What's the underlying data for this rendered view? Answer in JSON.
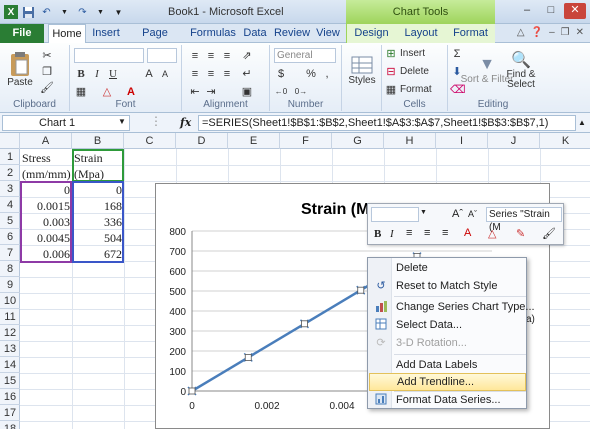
{
  "titlebar": {
    "title": "Book1  -  Microsoft Excel",
    "chart_tools": "Chart Tools",
    "qat": [
      "save-icon",
      "undo-icon",
      "redo-icon"
    ],
    "window_controls": [
      "–",
      "□",
      "✕"
    ]
  },
  "tabs": {
    "file": "File",
    "items": [
      "Home",
      "Insert",
      "Page Layout",
      "Formulas",
      "Data",
      "Review",
      "View",
      "Design",
      "Layout",
      "Format"
    ],
    "active": "Home"
  },
  "ribbon": {
    "clipboard": {
      "label": "Clipboard",
      "paste": "Paste"
    },
    "font": {
      "label": "Font",
      "bold": "B",
      "italic": "I",
      "underline": "U",
      "grow": "A",
      "shrink": "A"
    },
    "alignment": {
      "label": "Alignment"
    },
    "number": {
      "label": "Number",
      "format": "General",
      "currency": "$",
      "percent": "%",
      "comma": ","
    },
    "styles": {
      "label": "Styles"
    },
    "cells": {
      "label": "Cells",
      "insert": "Insert",
      "delete": "Delete",
      "format": "Format"
    },
    "editing": {
      "label": "Editing",
      "sort": "Sort & Filter",
      "find": "Find & Select"
    }
  },
  "formula_bar": {
    "name_box": "Chart 1",
    "fx": "fx",
    "formula": "=SERIES(Sheet1!$B$1:$B$2,Sheet1!$A$3:$A$7,Sheet1!$B$3:$B$7,1)"
  },
  "sheet": {
    "columns": [
      "A",
      "B",
      "C",
      "D",
      "E",
      "F",
      "G",
      "H",
      "I",
      "J",
      "K"
    ],
    "rows": [
      "1",
      "2",
      "3",
      "4",
      "5",
      "6",
      "7",
      "8",
      "9",
      "10",
      "11",
      "12",
      "13",
      "14",
      "15",
      "16",
      "17",
      "18"
    ],
    "cells": {
      "A1": "Stress",
      "B1": "Strain",
      "A2": "(mm/mm)",
      "B2": "(Mpa)",
      "A3": "0",
      "B3": "0",
      "A4": "0.0015",
      "B4": "168",
      "A5": "0.003",
      "B5": "336",
      "A6": "0.0045",
      "B6": "504",
      "A7": "0.006",
      "B7": "672"
    }
  },
  "chart": {
    "title": "Strain (M",
    "yaxis_ticks": [
      "800",
      "700",
      "600",
      "500",
      "400",
      "300",
      "200",
      "100",
      "0"
    ],
    "xaxis_ticks": [
      "0",
      "0.002",
      "0.004",
      "0.0"
    ],
    "legend_fragment": "a)"
  },
  "chart_data": {
    "type": "scatter",
    "title": "Strain (Mpa)",
    "series": [
      {
        "name": "Strain (Mpa)",
        "x": [
          0,
          0.0015,
          0.003,
          0.0045,
          0.006
        ],
        "y": [
          0,
          168,
          336,
          504,
          672
        ]
      }
    ],
    "xlim": [
      0,
      0.008
    ],
    "ylim": [
      0,
      800
    ],
    "grid": true,
    "line_color": "#4a7ebb"
  },
  "mini_toolbar": {
    "series_select": "Series \"Strain (M",
    "bold": "B",
    "italic": "I",
    "font_color_letter": "A"
  },
  "context_menu": {
    "items": [
      {
        "label": "Delete",
        "icon": "",
        "disabled": false
      },
      {
        "label": "Reset to Match Style",
        "icon": "reset-icon",
        "disabled": false
      },
      {
        "label": "Change Series Chart Type...",
        "icon": "chart-type-icon",
        "disabled": false
      },
      {
        "label": "Select Data...",
        "icon": "select-data-icon",
        "disabled": false
      },
      {
        "label": "3-D Rotation...",
        "icon": "rotation-icon",
        "disabled": true
      },
      {
        "label": "Add Data Labels",
        "icon": "",
        "disabled": false
      },
      {
        "label": "Add Trendline...",
        "icon": "",
        "disabled": false,
        "highlighted": true
      },
      {
        "label": "Format Data Series...",
        "icon": "format-series-icon",
        "disabled": false
      }
    ]
  }
}
